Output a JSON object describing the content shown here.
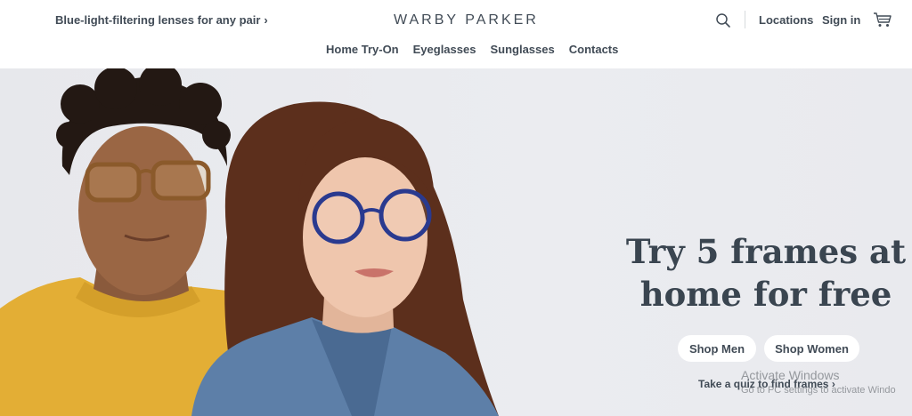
{
  "header": {
    "promo_text": "Blue-light-filtering lenses for any pair",
    "promo_chevron": "›",
    "logo": "WARBY PARKER",
    "locations": "Locations",
    "sign_in": "Sign in",
    "icons": [
      "search-icon",
      "cart-icon"
    ]
  },
  "nav": {
    "items": [
      {
        "label": "Home Try-On"
      },
      {
        "label": "Eyeglasses"
      },
      {
        "label": "Sunglasses"
      },
      {
        "label": "Contacts"
      }
    ]
  },
  "hero": {
    "headline_line1": "Try 5 frames at",
    "headline_line2": "home for free",
    "shop_men": "Shop Men",
    "shop_women": "Shop Women",
    "quiz": "Take a quiz to find frames",
    "quiz_chevron": "›"
  },
  "overlay": {
    "activate_title": "Activate Windows",
    "activate_sub": "Go to PC settings to activate Windo"
  },
  "colors": {
    "text": "#414b56",
    "hero_bg": "#e9eaee",
    "sweater": "#e9b43c",
    "denim": "#5d7fa8"
  }
}
